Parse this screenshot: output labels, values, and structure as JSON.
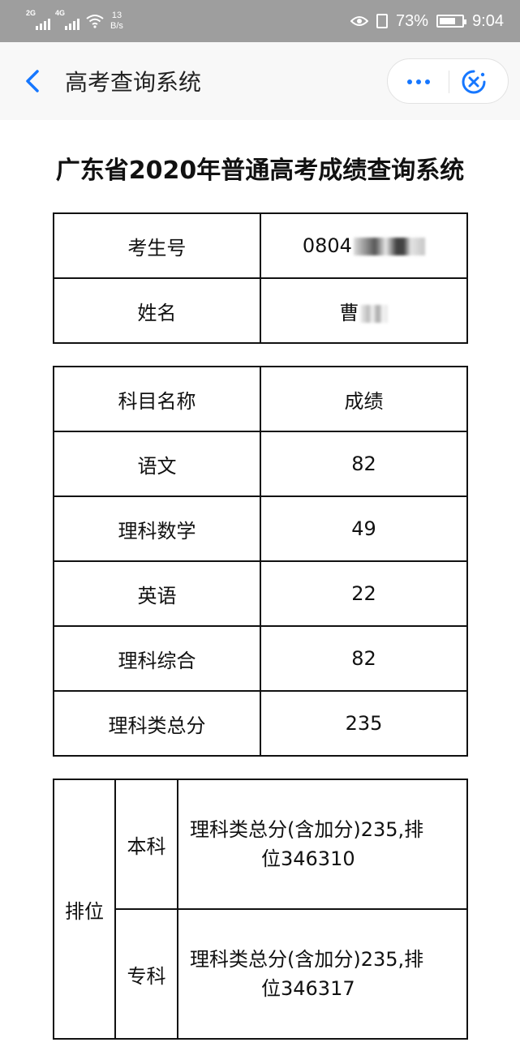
{
  "status_bar": {
    "network_1": "2G",
    "network_2": "4G",
    "speed_value": "13",
    "speed_unit": "B/s",
    "battery": "73%",
    "battery_level": 0.73,
    "time": "9:04"
  },
  "title_bar": {
    "title": "高考查询系统",
    "back_icon": "chevron-left-icon",
    "more_icon": "more-dots-icon",
    "close_icon": "close-circle-icon",
    "accent_color": "#1677ff"
  },
  "page_title": "广东省2020年普通高考成绩查询系统",
  "student": {
    "id_label": "考生号",
    "id_value": "0804",
    "name_label": "姓名",
    "name_value": "曹"
  },
  "scores": {
    "header_subject": "科目名称",
    "header_score": "成绩",
    "rows": [
      {
        "subject": "语文",
        "score": "82"
      },
      {
        "subject": "理科数学",
        "score": "49"
      },
      {
        "subject": "英语",
        "score": "22"
      },
      {
        "subject": "理科综合",
        "score": "82"
      },
      {
        "subject": "理科类总分",
        "score": "235"
      }
    ]
  },
  "ranking": {
    "label": "排位",
    "rows": [
      {
        "type": "本科",
        "detail_1": "理科类总分(含加分)235,排",
        "detail_2": "位346310"
      },
      {
        "type": "专科",
        "detail_1": "理科类总分(含加分)235,排",
        "detail_2": "位346317"
      }
    ]
  }
}
